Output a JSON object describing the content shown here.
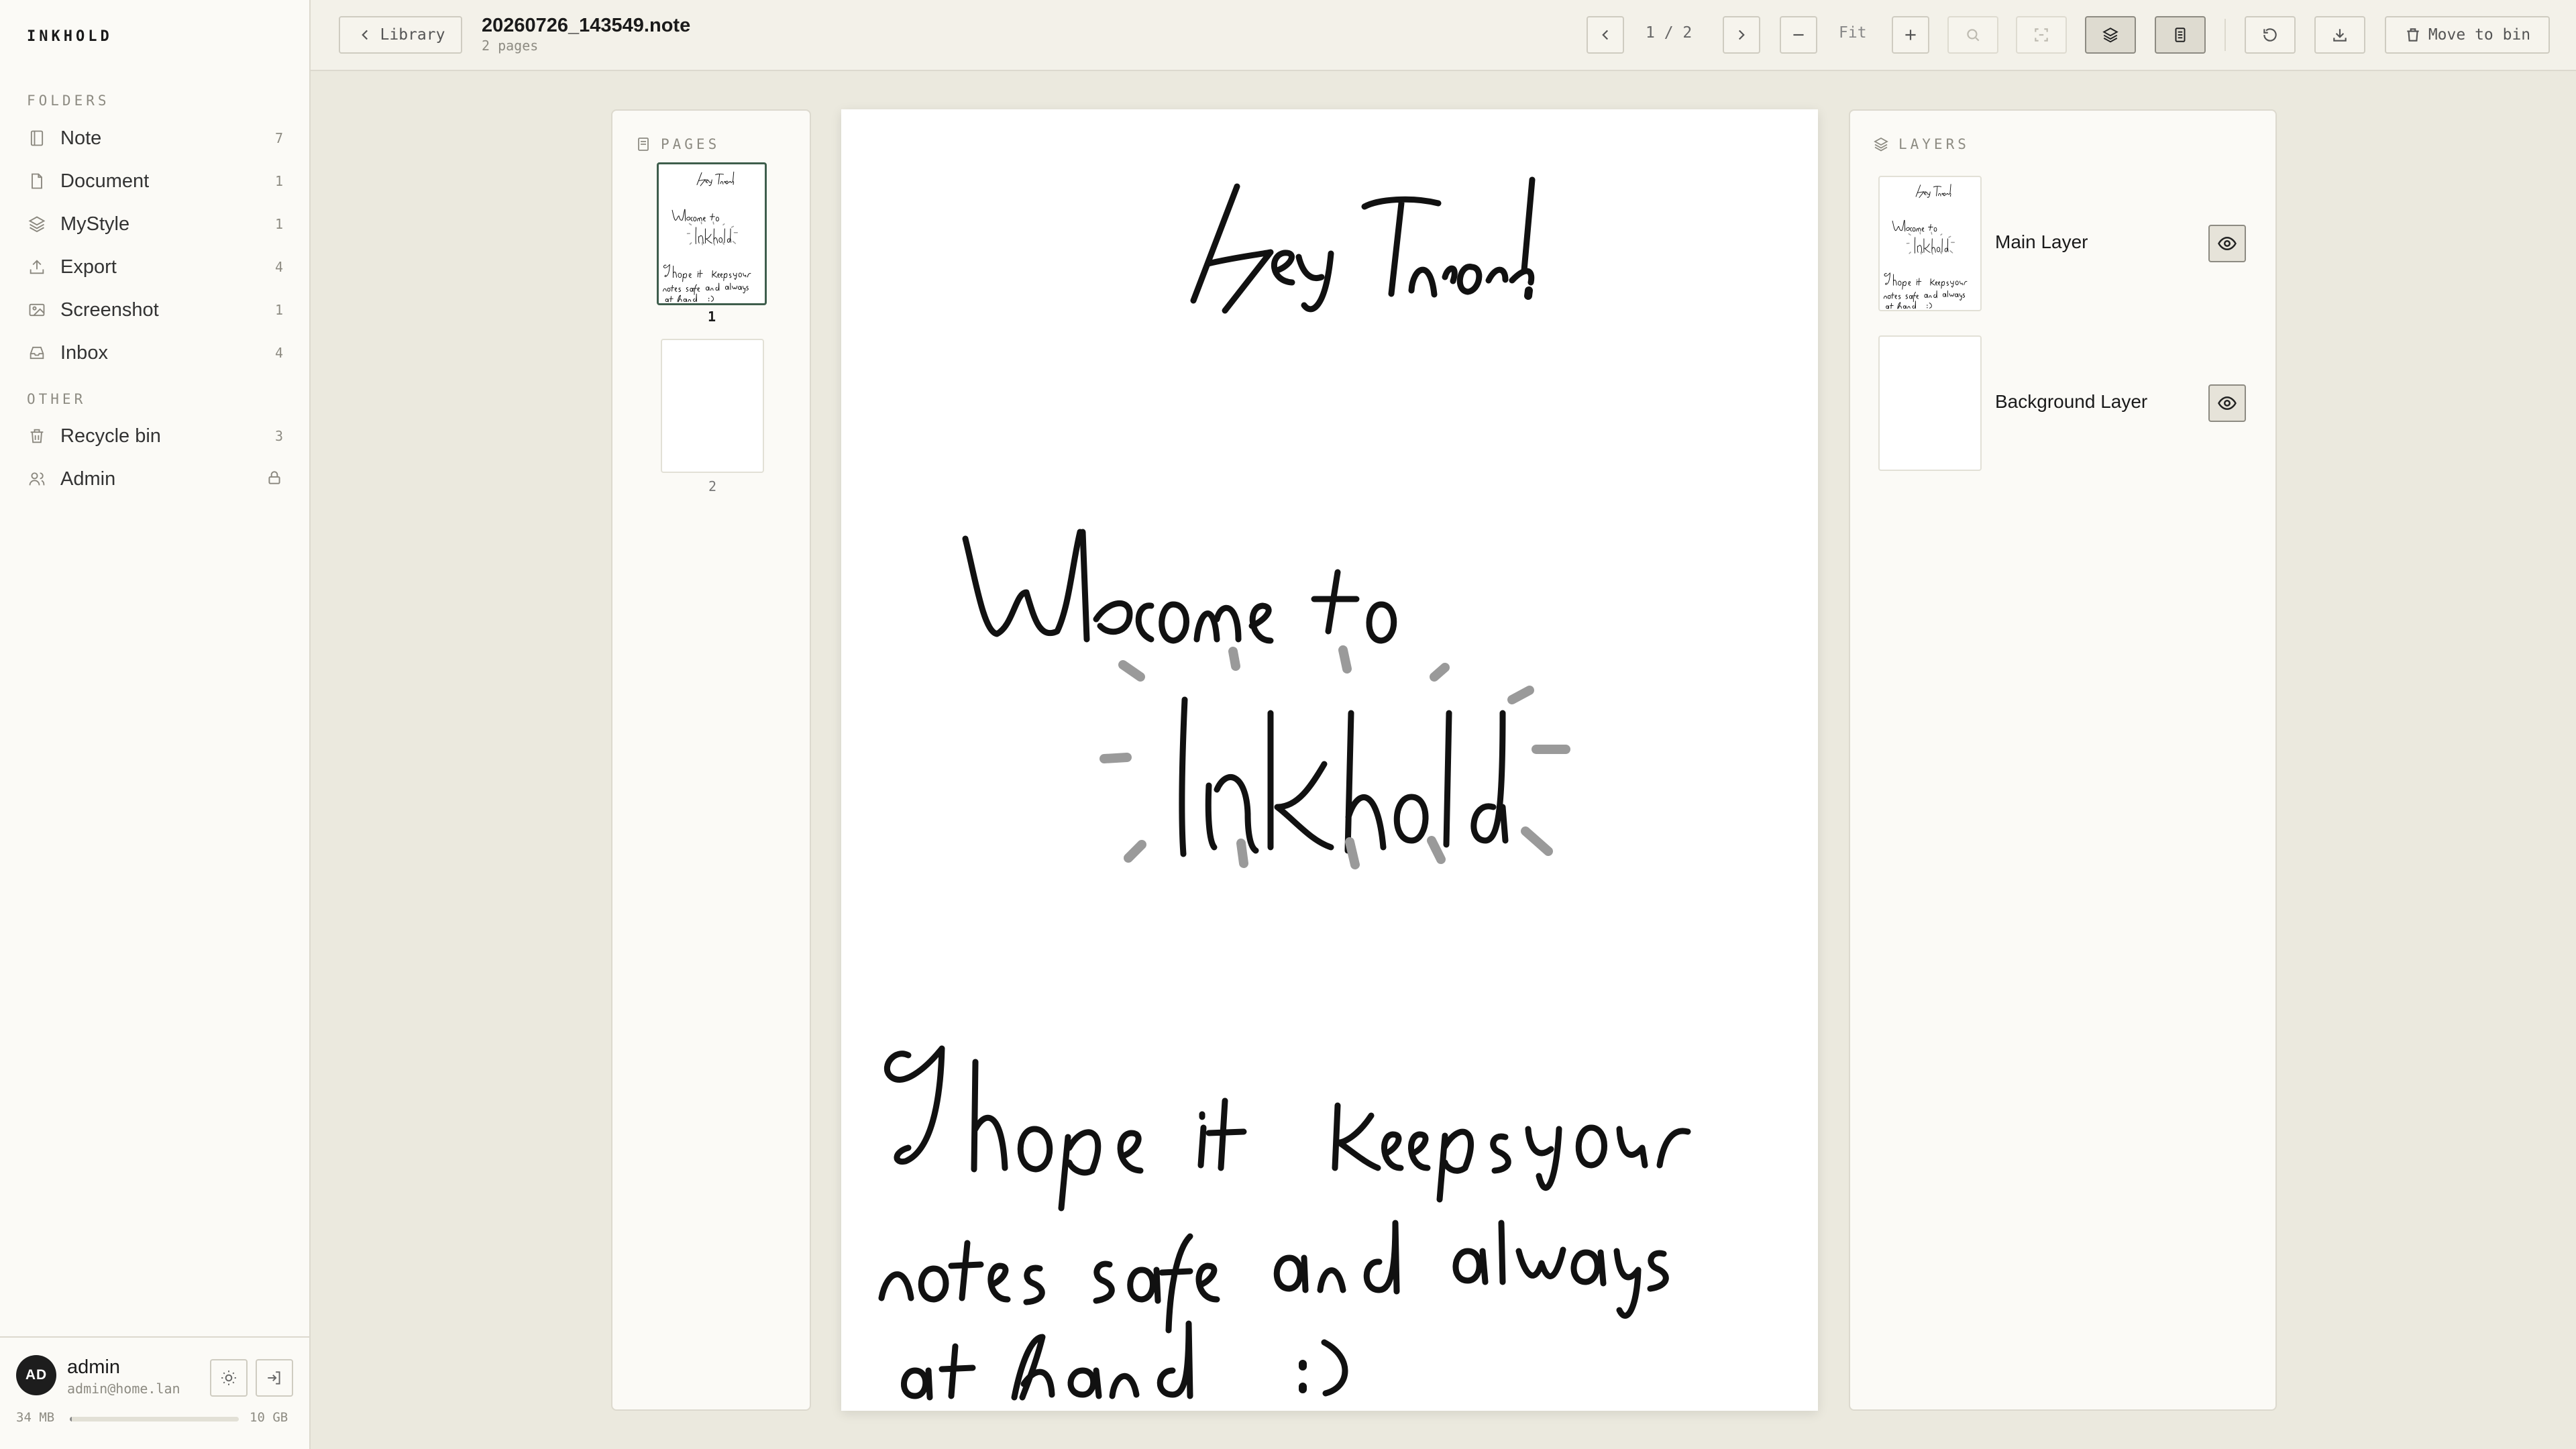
{
  "app": {
    "brand": "INKHOLD"
  },
  "sidebar": {
    "folders_label": "FOLDERS",
    "folders": [
      {
        "label": "Note",
        "count": "7",
        "icon": "notebook-icon"
      },
      {
        "label": "Document",
        "count": "1",
        "icon": "document-icon"
      },
      {
        "label": "MyStyle",
        "count": "1",
        "icon": "layers-icon"
      },
      {
        "label": "Export",
        "count": "4",
        "icon": "upload-icon"
      },
      {
        "label": "Screenshot",
        "count": "1",
        "icon": "image-icon"
      },
      {
        "label": "Inbox",
        "count": "4",
        "icon": "inbox-icon"
      }
    ],
    "other_label": "OTHER",
    "other": [
      {
        "label": "Recycle bin",
        "count": "3",
        "icon": "trash-icon"
      },
      {
        "label": "Admin",
        "icon": "users-icon",
        "badge": "lock-icon"
      }
    ],
    "user": {
      "initials": "AD",
      "name": "admin",
      "email": "admin@home.lan"
    },
    "storage": {
      "used": "34 MB",
      "total": "10 GB",
      "fraction": 0.0034
    }
  },
  "topbar": {
    "back_label": "Library",
    "file_name": "20260726_143549.note",
    "file_sub": "2 pages",
    "page_indicator": "1 / 2",
    "zoom_label": "Fit",
    "move_to_bin_label": "Move to bin"
  },
  "pages_panel": {
    "title": "PAGES",
    "pages": [
      {
        "number": "1",
        "selected": true
      },
      {
        "number": "2",
        "selected": false
      }
    ]
  },
  "layers_panel": {
    "title": "LAYERS",
    "layers": [
      {
        "name": "Main Layer"
      },
      {
        "name": "Background Layer"
      }
    ]
  },
  "note_content": {
    "lines": [
      "Hey there!",
      "Welcome to",
      "Inkhold",
      "I hope it keeps your",
      "notes safe and always",
      "at hand :)"
    ]
  },
  "colors": {
    "accent": "#3f5e4d",
    "ink": "#111111",
    "rays": "#9a9a9a",
    "background": "#ebe9de"
  }
}
